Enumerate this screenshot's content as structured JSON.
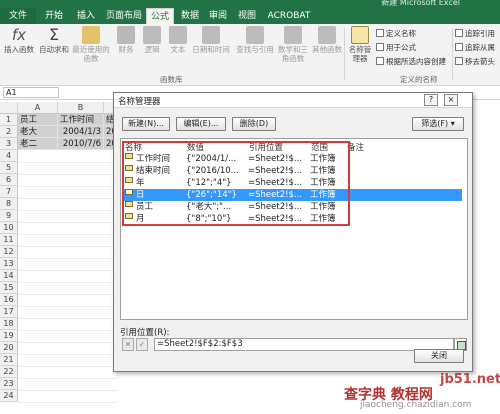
{
  "window": {
    "title": "新建 Microsoft Excel"
  },
  "ribbon": {
    "tabs": [
      "文件",
      "开始",
      "插入",
      "页面布局",
      "公式",
      "数据",
      "审阅",
      "视图",
      "ACROBAT"
    ],
    "active_tab": "公式",
    "library": {
      "buttons": [
        "插入函数",
        "自动求和",
        "最近使用的函数",
        "财务",
        "逻辑",
        "文本",
        "日期和时间",
        "查找与引用",
        "数学和三角函数",
        "其他函数"
      ],
      "group_label": "函数库"
    },
    "names": {
      "manager": "名称管理器",
      "define": "定义名称",
      "use_in_formula": "用于公式",
      "create_from_selection": "根据所选内容创建",
      "group_label": "定义的名称"
    },
    "audit": {
      "trace_precedents": "追踪引用",
      "trace_dependents": "追踪从属",
      "remove_arrows": "移去箭头"
    }
  },
  "formula_bar": {
    "name_box": "A1"
  },
  "sheet": {
    "columns": [
      "A",
      "B"
    ],
    "rows": [
      "1",
      "2",
      "3",
      "4",
      "5",
      "6",
      "7",
      "8",
      "9",
      "10",
      "11",
      "12",
      "13",
      "14",
      "15",
      "16",
      "17",
      "18",
      "19",
      "20",
      "21",
      "22",
      "23",
      "24"
    ],
    "data": [
      [
        "员工",
        "工作时间",
        "结"
      ],
      [
        "老大",
        "2004/1/3",
        "20"
      ],
      [
        "老二",
        "2010/7/6",
        "20"
      ]
    ]
  },
  "dialog": {
    "title": "名称管理器",
    "help": "?",
    "close": "×",
    "new_button": "新建(N)...",
    "edit_button": "编辑(E)...",
    "delete_button": "删除(D)",
    "filter_button": "筛选(F)",
    "headers": [
      "名称",
      "数值",
      "引用位置",
      "范围",
      "备注"
    ],
    "names": [
      {
        "name": "工作时间",
        "value": "{\"2004/1/...",
        "refers_to": "=Sheet2!$...",
        "scope": "工作簿"
      },
      {
        "name": "结束时间",
        "value": "{\"2016/10...",
        "refers_to": "=Sheet2!$...",
        "scope": "工作簿"
      },
      {
        "name": "年",
        "value": "{\"12\";\"4\"}",
        "refers_to": "=Sheet2!$...",
        "scope": "工作簿"
      },
      {
        "name": "日",
        "value": "{\"26\";\"14\"}",
        "refers_to": "=Sheet2!$...",
        "scope": "工作簿"
      },
      {
        "name": "员工",
        "value": "{\"老大\";\"...",
        "refers_to": "=Sheet2!$...",
        "scope": "工作簿"
      },
      {
        "name": "月",
        "value": "{\"8\";\"10\"}",
        "refers_to": "=Sheet2!$...",
        "scope": "工作簿"
      }
    ],
    "selected_index": 3,
    "refers_to_label": "引用位置(R):",
    "refers_to_value": "=Sheet2!$F$2:$F$3",
    "close_button": "关闭"
  },
  "watermark": {
    "site1": "查字典 教程网",
    "site2": "jb51.net",
    "site3": "jiaocheng.chazidian.com"
  },
  "colors": {
    "excel_green": "#217346",
    "selection_blue": "#3399ff",
    "highlight_red": "#d33b3b"
  }
}
